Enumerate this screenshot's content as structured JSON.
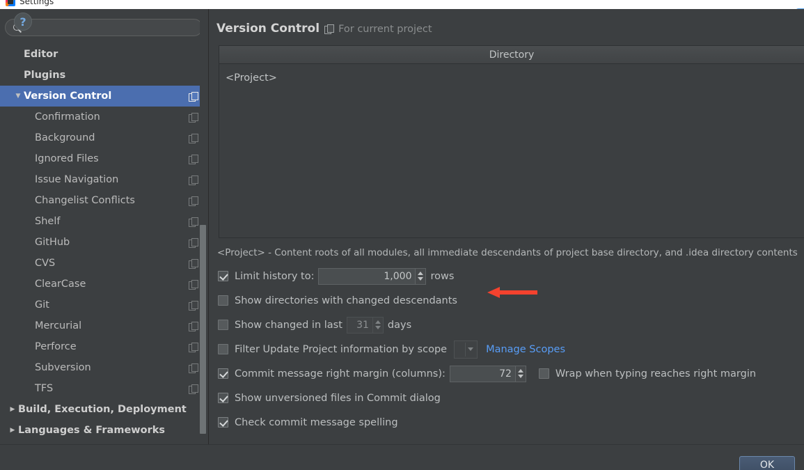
{
  "window": {
    "title": "Settings",
    "icon": "intellij-logo-icon"
  },
  "sidebar": {
    "search": {
      "value": "",
      "placeholder": ""
    },
    "items": [
      {
        "label": "Editor",
        "level": "top",
        "arrow": "",
        "copy": false,
        "selected": false
      },
      {
        "label": "Plugins",
        "level": "top",
        "arrow": "",
        "copy": false,
        "selected": false
      },
      {
        "label": "Version Control",
        "level": "top",
        "arrow": "▼",
        "copy": true,
        "selected": true
      },
      {
        "label": "Confirmation",
        "level": "child",
        "arrow": "",
        "copy": true,
        "selected": false
      },
      {
        "label": "Background",
        "level": "child",
        "arrow": "",
        "copy": true,
        "selected": false
      },
      {
        "label": "Ignored Files",
        "level": "child",
        "arrow": "",
        "copy": true,
        "selected": false
      },
      {
        "label": "Issue Navigation",
        "level": "child",
        "arrow": "",
        "copy": true,
        "selected": false
      },
      {
        "label": "Changelist Conflicts",
        "level": "child",
        "arrow": "",
        "copy": true,
        "selected": false
      },
      {
        "label": "Shelf",
        "level": "child",
        "arrow": "",
        "copy": true,
        "selected": false
      },
      {
        "label": "GitHub",
        "level": "child",
        "arrow": "",
        "copy": true,
        "selected": false
      },
      {
        "label": "CVS",
        "level": "child",
        "arrow": "",
        "copy": true,
        "selected": false
      },
      {
        "label": "ClearCase",
        "level": "child",
        "arrow": "",
        "copy": true,
        "selected": false
      },
      {
        "label": "Git",
        "level": "child",
        "arrow": "",
        "copy": true,
        "selected": false
      },
      {
        "label": "Mercurial",
        "level": "child",
        "arrow": "",
        "copy": true,
        "selected": false
      },
      {
        "label": "Perforce",
        "level": "child",
        "arrow": "",
        "copy": true,
        "selected": false
      },
      {
        "label": "Subversion",
        "level": "child",
        "arrow": "",
        "copy": true,
        "selected": false
      },
      {
        "label": "TFS",
        "level": "child",
        "arrow": "",
        "copy": true,
        "selected": false
      },
      {
        "label": "Build, Execution, Deployment",
        "level": "toparrow",
        "arrow": "▶",
        "copy": false,
        "selected": false
      },
      {
        "label": "Languages & Frameworks",
        "level": "toparrow",
        "arrow": "▶",
        "copy": false,
        "selected": false
      }
    ]
  },
  "main": {
    "title": "Version Control",
    "scope_note": "For current project",
    "table": {
      "column_header": "Directory",
      "rows": [
        "<Project>"
      ]
    },
    "note": "<Project> - Content roots of all modules, all immediate descendants of project base directory, and .idea directory contents",
    "options": {
      "limit_history": {
        "label": "Limit history to:",
        "checked": true,
        "value": "1,000",
        "suffix": "rows"
      },
      "show_directories": {
        "label": "Show directories with changed descendants",
        "checked": false
      },
      "show_changed_last": {
        "label": "Show changed in last",
        "checked": false,
        "value": "31",
        "suffix": "days"
      },
      "filter_by_scope": {
        "label": "Filter Update Project information by scope",
        "checked": false,
        "combo_value": "",
        "link_label": "Manage Scopes"
      },
      "commit_margin": {
        "label": "Commit message right margin (columns):",
        "checked": true,
        "value": "72"
      },
      "wrap_typing": {
        "label": "Wrap when typing reaches right margin",
        "checked": false
      },
      "show_unversioned": {
        "label": "Show unversioned files in Commit dialog",
        "checked": true
      },
      "check_spelling": {
        "label": "Check commit message spelling",
        "checked": true
      }
    }
  },
  "footer": {
    "help_label": "?",
    "ok_label": "OK"
  },
  "annotation": {
    "arrow_color": "#f4422e"
  }
}
